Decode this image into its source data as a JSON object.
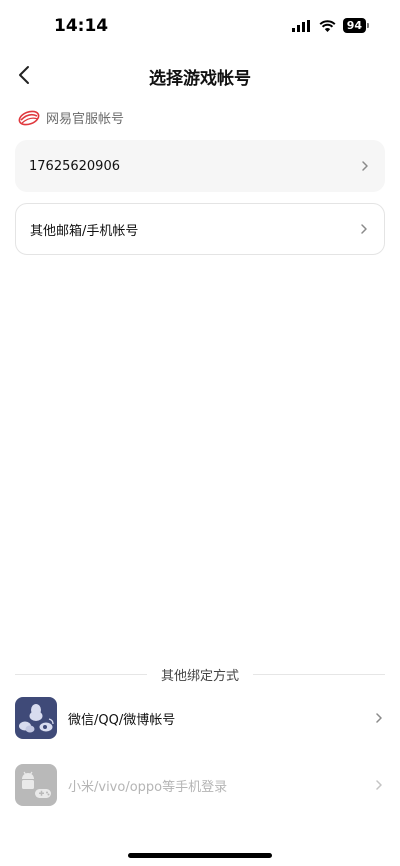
{
  "status": {
    "time": "14:14",
    "battery": "94"
  },
  "nav": {
    "title": "选择游戏帐号"
  },
  "section": {
    "label": "网易官服帐号"
  },
  "accounts": [
    {
      "label": "17625620906"
    },
    {
      "label": "其他邮箱/手机帐号"
    }
  ],
  "alt": {
    "heading": "其他绑定方式",
    "items": [
      {
        "label": "微信/QQ/微博帐号"
      },
      {
        "label": "小米/vivo/oppo等手机登录"
      }
    ]
  },
  "colors": {
    "accent": "#e0383e",
    "alt_icon_bg": "#3f4a78",
    "disabled": "#b9b9b9"
  }
}
